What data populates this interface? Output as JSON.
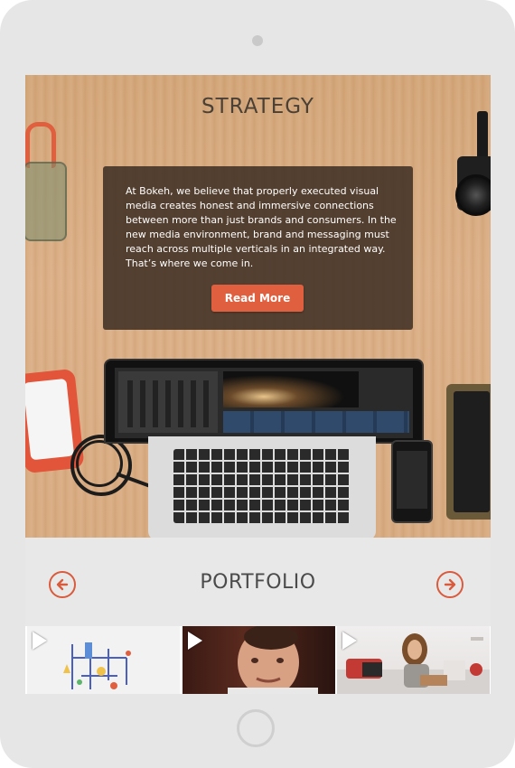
{
  "hero": {
    "title": "STRATEGY",
    "body": "At Bokeh, we believe that properly executed visual media creates honest and immersive connections between more than just brands and consumers. In the new media environment, brand and messaging must reach across multiple verticals in an integrated way. That’s where we come in.",
    "button_label": "Read More"
  },
  "portfolio": {
    "title": "PORTFOLIO",
    "prev_icon": "arrow-left-icon",
    "next_icon": "arrow-right-icon",
    "thumbnails": [
      {
        "icon": "play-icon",
        "subject": "diagram illustration"
      },
      {
        "icon": "play-icon",
        "subject": "chef portrait"
      },
      {
        "icon": "play-icon",
        "subject": "woman on sofa"
      }
    ]
  },
  "colors": {
    "accent": "#e05f3f",
    "card_bg": "#3c2d23",
    "device": "#e6e6e6",
    "title_text": "#4b4b4b"
  }
}
